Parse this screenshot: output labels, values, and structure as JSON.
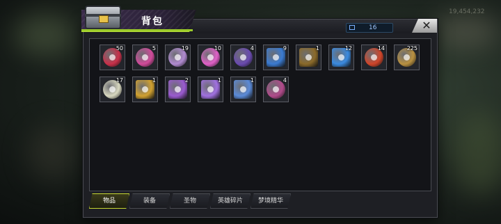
{
  "panel": {
    "title": "背包",
    "capacity_count": "16",
    "close_label": "✕"
  },
  "items": [
    {
      "qty": "50",
      "icon": "red-candy-icon",
      "color": "#c8304a"
    },
    {
      "qty": "5",
      "icon": "film-reel-icon",
      "color": "#d04a9a"
    },
    {
      "qty": "19",
      "icon": "winged-orb-icon",
      "color": "#b08ad0"
    },
    {
      "qty": "10",
      "icon": "pink-gem-icon",
      "color": "#e060c8"
    },
    {
      "qty": "4",
      "icon": "star-coin-icon",
      "color": "#6a4ab0"
    },
    {
      "qty": "9",
      "icon": "blue-map-icon",
      "color": "#3a7ad0"
    },
    {
      "qty": "1",
      "icon": "bronze-medal-icon",
      "color": "#8a6a2a"
    },
    {
      "qty": "12",
      "icon": "ticket-card-icon",
      "color": "#3a8ae0"
    },
    {
      "qty": "14",
      "icon": "poker-chip-icon",
      "color": "#d0452a"
    },
    {
      "qty": "225",
      "icon": "bullet-icon",
      "color": "#b89040"
    },
    {
      "qty": "17",
      "icon": "feather-icon",
      "color": "#d8d8c0"
    },
    {
      "qty": "1",
      "icon": "gold-scroll-icon",
      "color": "#d0a030"
    },
    {
      "qty": "2",
      "icon": "purple-scroll-icon",
      "color": "#9a5ad0"
    },
    {
      "qty": "1",
      "icon": "purple-shirt-icon",
      "color": "#a070e0"
    },
    {
      "qty": "1",
      "icon": "blue-shirt-icon",
      "color": "#5a8ad8"
    },
    {
      "qty": "4",
      "icon": "gem-ring-icon",
      "color": "#b04a8a"
    }
  ],
  "tabs": [
    {
      "label": "物品",
      "active": true
    },
    {
      "label": "装备",
      "active": false
    },
    {
      "label": "圣物",
      "active": false
    },
    {
      "label": "英雄碎片",
      "active": false
    },
    {
      "label": "梦境精华",
      "active": false
    }
  ],
  "hud": {
    "currency": "19,454,232"
  }
}
